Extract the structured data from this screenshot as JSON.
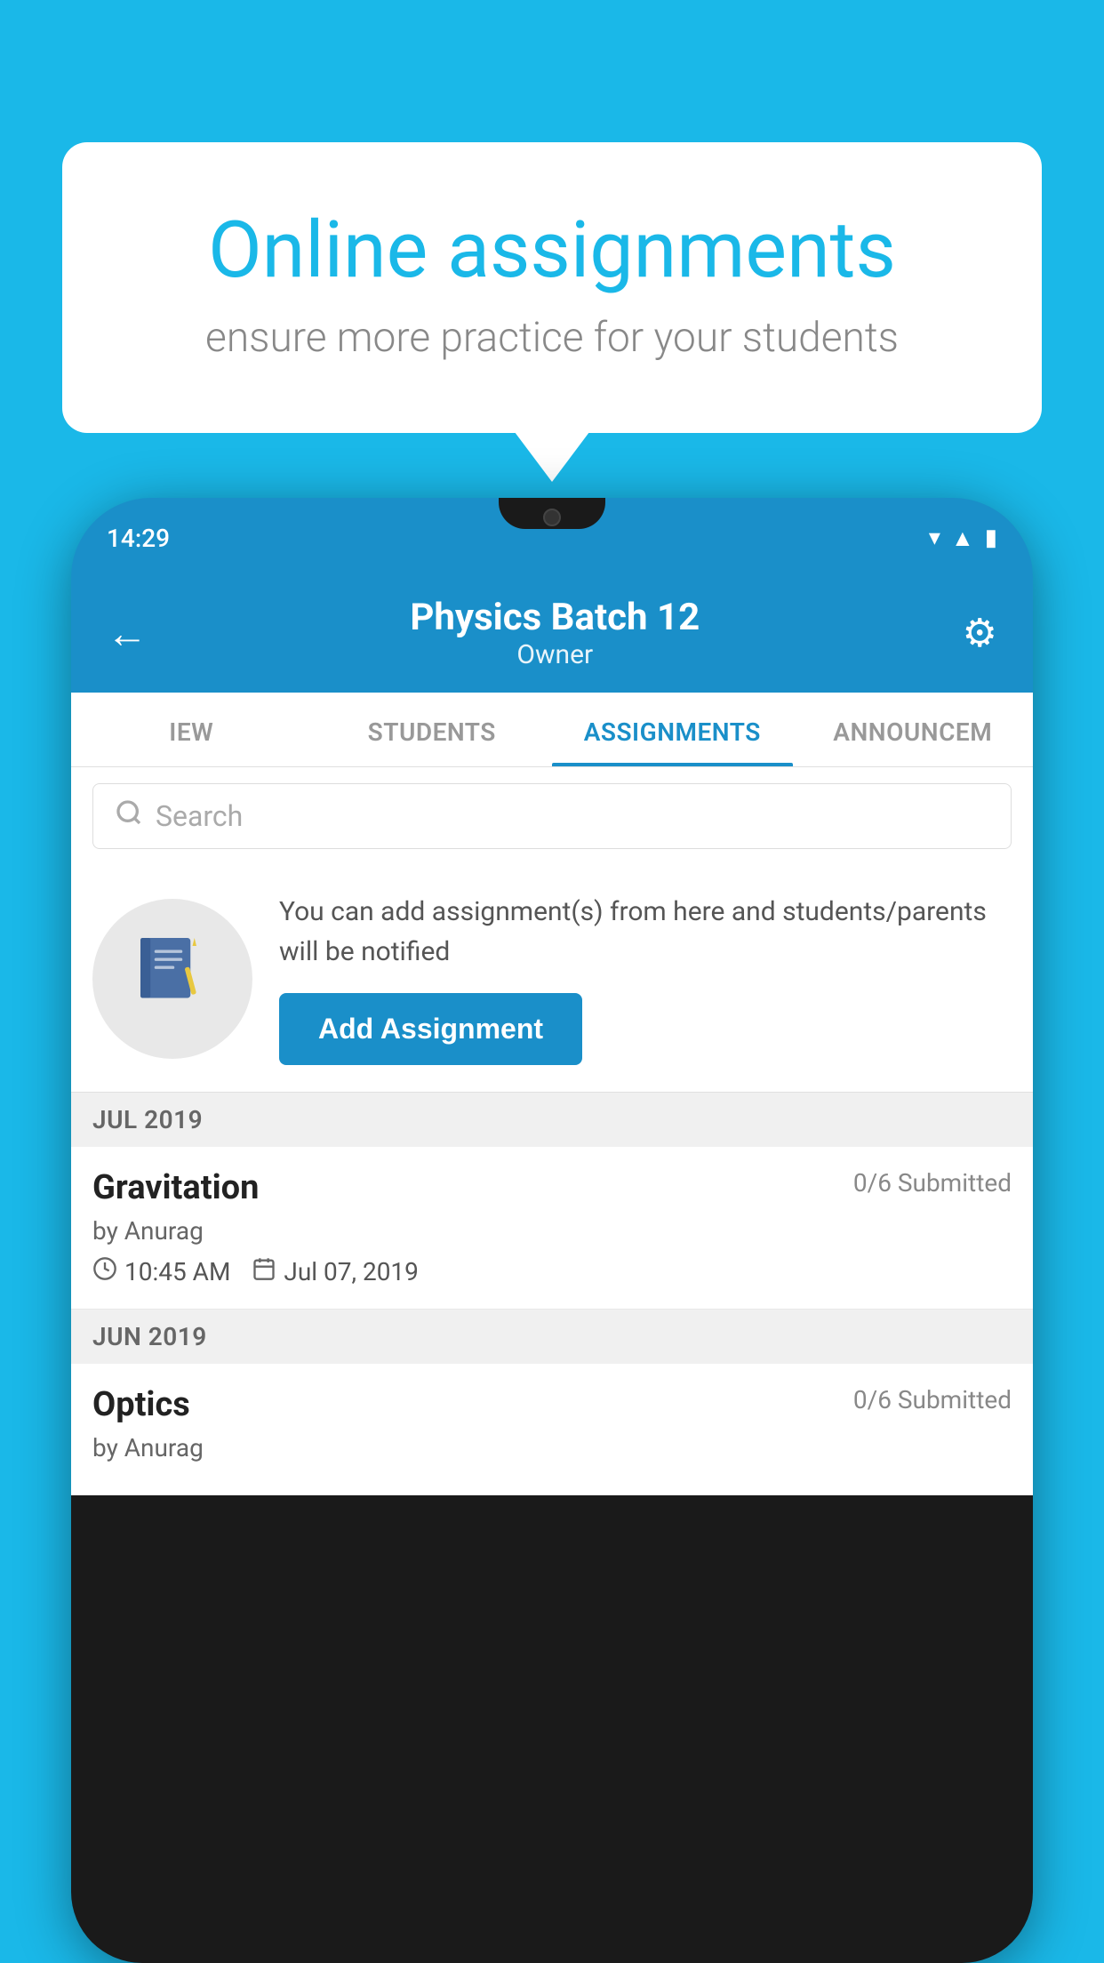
{
  "background_color": "#1ab8e8",
  "speech_bubble": {
    "title": "Online assignments",
    "subtitle": "ensure more practice for your students"
  },
  "phone": {
    "status_bar": {
      "time": "14:29",
      "icons": [
        "wifi",
        "signal",
        "battery"
      ]
    },
    "header": {
      "title": "Physics Batch 12",
      "subtitle": "Owner",
      "back_label": "←",
      "settings_label": "⚙"
    },
    "tabs": [
      {
        "label": "IEW",
        "active": false
      },
      {
        "label": "STUDENTS",
        "active": false
      },
      {
        "label": "ASSIGNMENTS",
        "active": true
      },
      {
        "label": "ANNOUNCEM",
        "active": false
      }
    ],
    "search": {
      "placeholder": "Search"
    },
    "promo": {
      "text": "You can add assignment(s) from here and students/parents will be notified",
      "button_label": "Add Assignment"
    },
    "sections": [
      {
        "header": "JUL 2019",
        "assignments": [
          {
            "title": "Gravitation",
            "submitted": "0/6 Submitted",
            "author": "by Anurag",
            "time": "10:45 AM",
            "date": "Jul 07, 2019"
          }
        ]
      },
      {
        "header": "JUN 2019",
        "assignments": [
          {
            "title": "Optics",
            "submitted": "0/6 Submitted",
            "author": "by Anurag",
            "time": "",
            "date": ""
          }
        ]
      }
    ]
  }
}
